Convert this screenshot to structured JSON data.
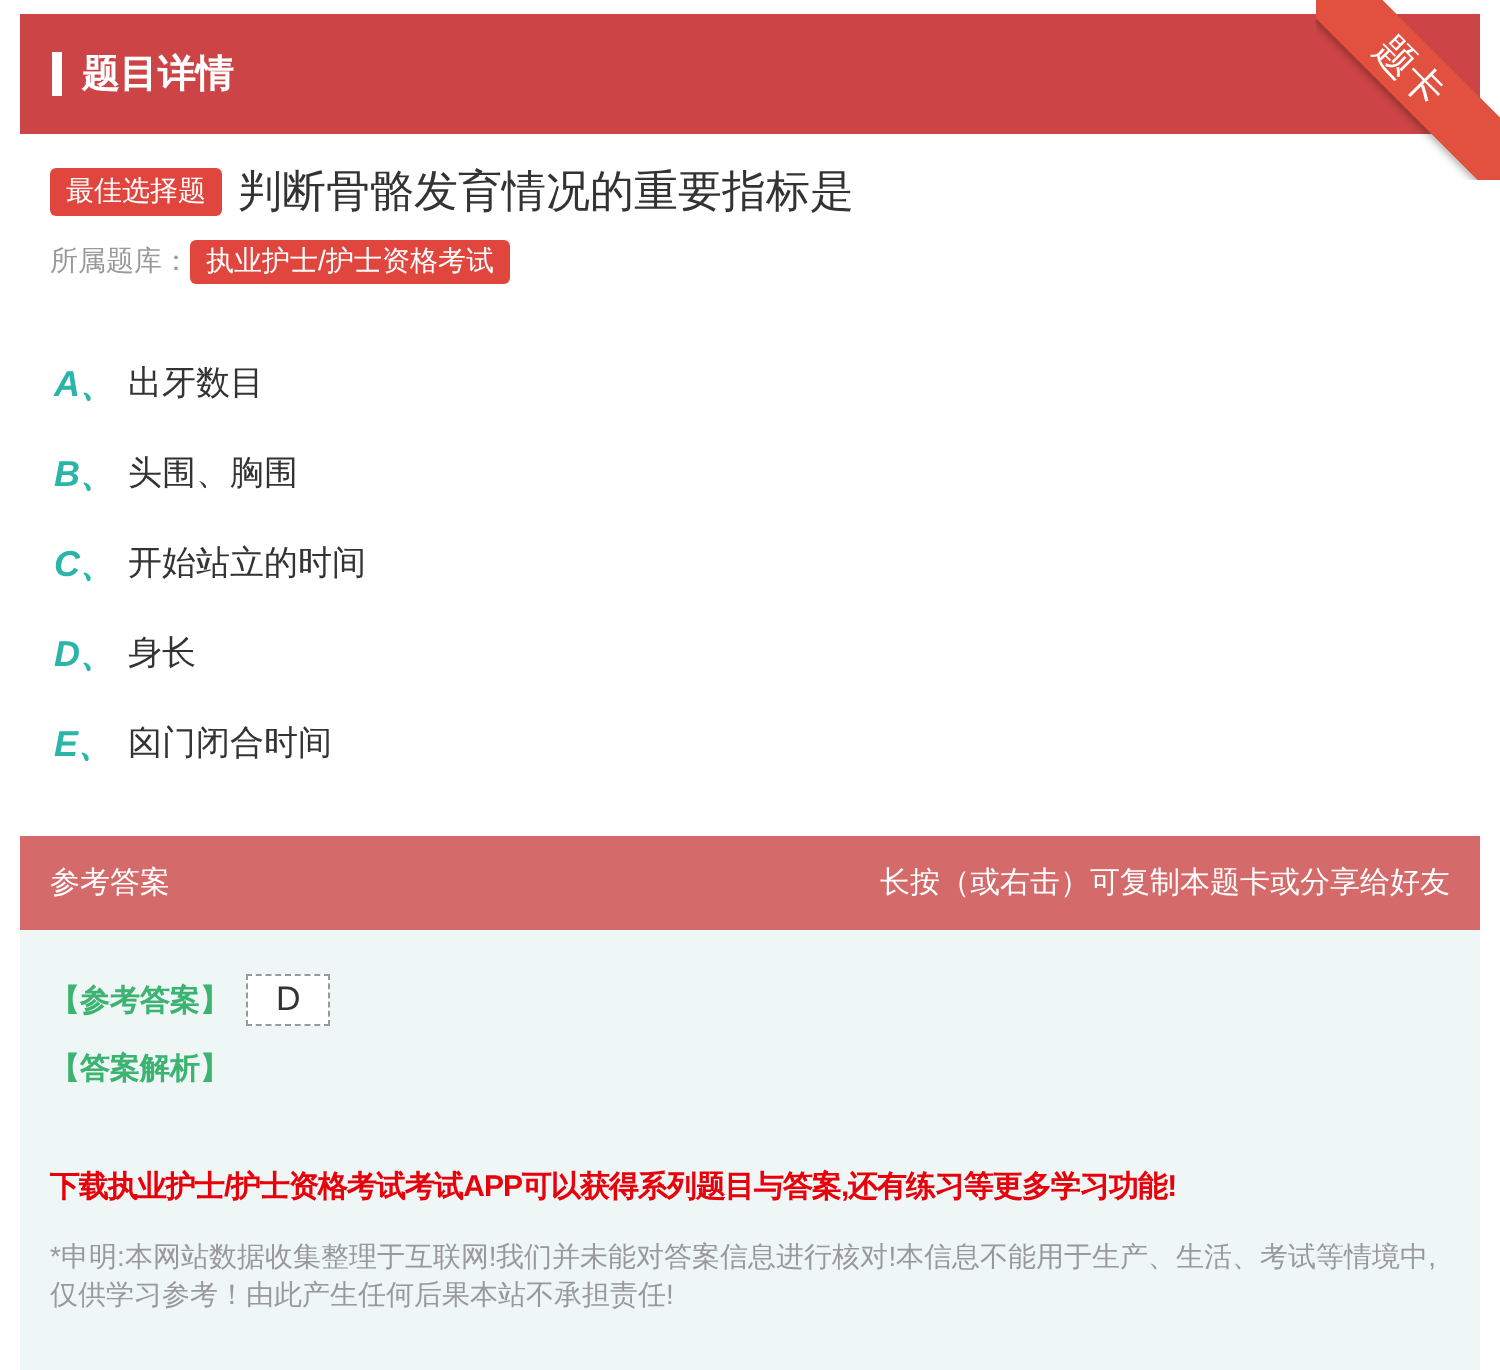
{
  "header": {
    "title": "题目详情",
    "corner_tab": "题卡"
  },
  "question": {
    "type": "最佳选择题",
    "text": "判断骨骼发育情况的重要指标是",
    "bank_label": "所属题库：",
    "bank": "执业护士/护士资格考试"
  },
  "options": [
    {
      "letter": "A",
      "sep": "、",
      "text": "出牙数目"
    },
    {
      "letter": "B",
      "sep": "、",
      "text": "头围、胸围"
    },
    {
      "letter": "C",
      "sep": "、",
      "text": "开始站立的时间"
    },
    {
      "letter": "D",
      "sep": "、",
      "text": "身长"
    },
    {
      "letter": "E",
      "sep": "、",
      "text": "囟门闭合时间"
    }
  ],
  "answer": {
    "title": "参考答案",
    "hint": "长按（或右击）可复制本题卡或分享给好友",
    "answer_label": "【参考答案】",
    "answer_value": "D",
    "analysis_label": "【答案解析】",
    "promo": "下载执业护士/护士资格考试考试APP可以获得系列题目与答案,还有练习等更多学习功能!",
    "disclaimer": "*申明:本网站数据收集整理于互联网!我们并未能对答案信息进行核对!本信息不能用于生产、生活、考试等情境中,仅供学习参考！由此产生任何后果本站不承担责任!"
  }
}
